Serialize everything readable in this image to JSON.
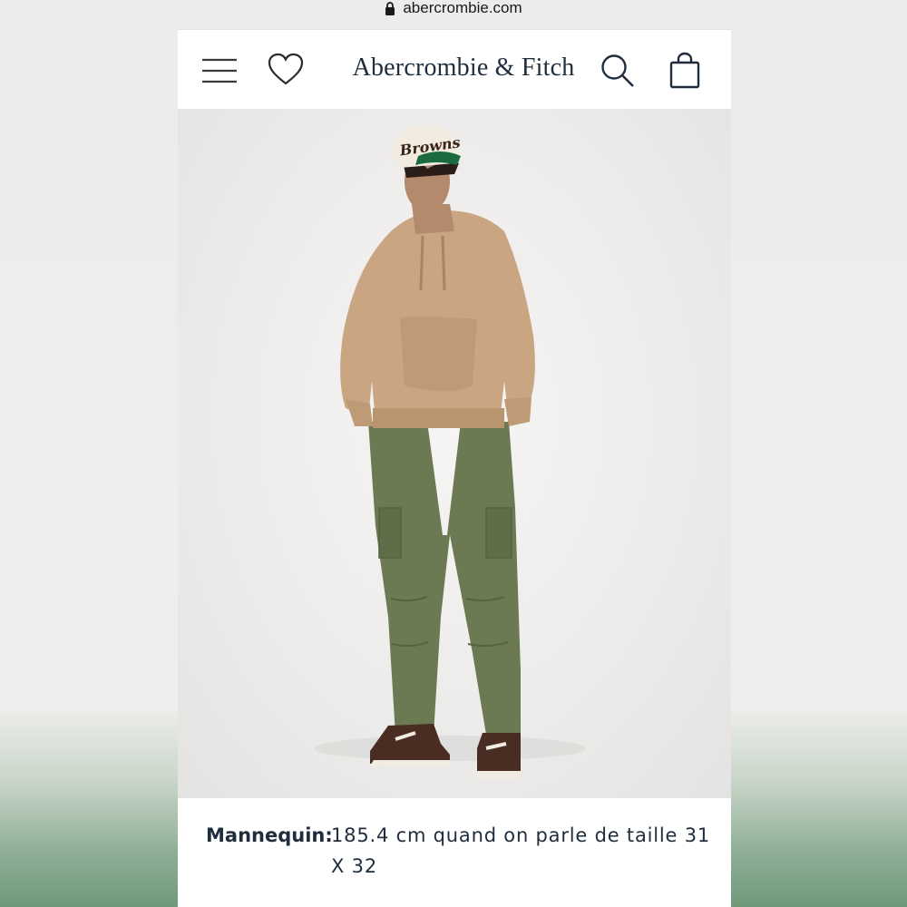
{
  "browser": {
    "url": "abercrombie.com"
  },
  "header": {
    "brand": "Abercrombie & Fitch",
    "icons": [
      "menu-icon",
      "heart-icon",
      "search-icon",
      "bag-icon"
    ]
  },
  "product_image": {
    "cap_text": "Browns"
  },
  "caption": {
    "label": "Mannequin:",
    "value": "185.4 cm quand on parle de taille 31 X 32"
  },
  "colors": {
    "brand_navy": "#1f2d3d",
    "hoodie": "#c9a582",
    "pants": "#6b7a52"
  }
}
